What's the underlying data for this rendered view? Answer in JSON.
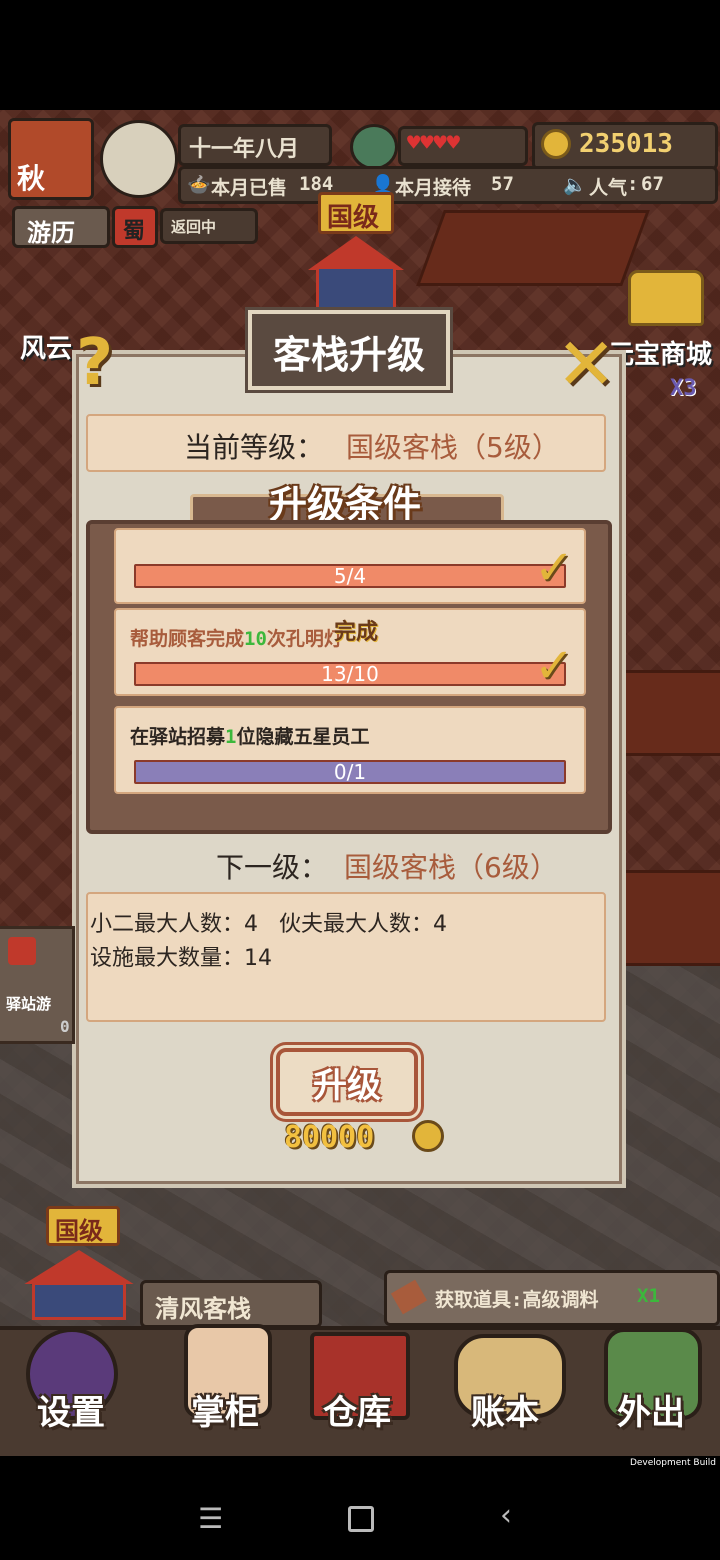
{
  "hud": {
    "season": "秋",
    "date": "十一年八月",
    "coins": "235013",
    "sold_label": "本月已售",
    "sold_value": "184",
    "served_label": "本月接待",
    "served_value": "57",
    "popularity_label": "人气",
    "popularity_value": "67",
    "travel_label": "游历",
    "travel_region": "蜀",
    "travel_status": "返回中",
    "hearts": "♥♥♥♥",
    "event_label": "风云",
    "shop_label": "元宝商城",
    "shop_badge": "X3"
  },
  "modal": {
    "rank_badge": "国级",
    "title": "客栈升级",
    "current_level_label": "当前等级：",
    "current_level_value": "国级客栈（5级）",
    "conditions_title": "升级条件",
    "conditions": [
      {
        "text_pre": "",
        "text_num": "",
        "text_post": "",
        "progress_text": "5/4",
        "progress": 1.0,
        "done": true
      },
      {
        "text_pre": "帮助顾客完成",
        "text_num": "10",
        "text_post": "次孔明灯",
        "progress_text": "13/10",
        "progress": 1.0,
        "done": true,
        "done_label": "完成"
      },
      {
        "text_pre": "在驿站招募",
        "text_num": "1",
        "text_post": "位隐藏五星员工",
        "progress_text": "0/1",
        "progress": 0.0,
        "done": false
      }
    ],
    "next_level_label": "下一级：",
    "next_level_value": "国级客栈（6级）",
    "benefits_line1": "小二最大人数：4   伙夫最大人数：4",
    "benefits_line2": "设施最大数量：14",
    "upgrade_button": "升级",
    "cost": "80000",
    "help_icon": "?",
    "close_icon": "✕"
  },
  "bottom": {
    "inn_rank": "国级",
    "inn_name": "清风客栈",
    "item_notice": "获取道具:高级调料",
    "item_count": "X1",
    "left_panel_text": "驿站游",
    "left_panel_num": "0",
    "nav": [
      {
        "label": "设置",
        "icon": "yin-yang-gear-icon"
      },
      {
        "label": "掌柜",
        "icon": "shopkeeper-icon"
      },
      {
        "label": "仓库",
        "icon": "warehouse-chest-icon"
      },
      {
        "label": "账本",
        "icon": "scroll-ledger-icon"
      },
      {
        "label": "外出",
        "icon": "travel-bag-icon"
      }
    ]
  },
  "dev_build": "Development Build",
  "colors": {
    "progress_done": "#f08a68",
    "progress_empty": "#8a7fb8",
    "accent_gold": "#e2b53a",
    "number_green": "#3cb83c"
  }
}
